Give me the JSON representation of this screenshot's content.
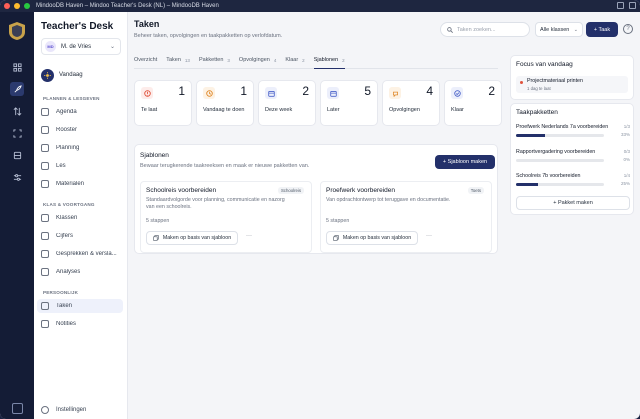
{
  "window": {
    "title": "MindooDB Haven – Mindoo Teacher's Desk (NL) – MindooDB Haven"
  },
  "app": {
    "brand": "Teacher's Desk"
  },
  "user": {
    "initials": "MD",
    "name": "M. de Vries"
  },
  "sidebar": {
    "today": "Vandaag",
    "section1": "PLANNEN & LESGEVEN",
    "items1": [
      "Agenda",
      "Rooster",
      "Planning",
      "Les",
      "Materialen"
    ],
    "section2": "KLAS & VOORTGANG",
    "items2": [
      "Klassen",
      "Cijfers",
      "Gesprekken & versla...",
      "Analyses"
    ],
    "section3": "PERSOONLIJK",
    "items3": [
      "Taken",
      "Notities"
    ],
    "settings": "Instellingen"
  },
  "header": {
    "title": "Taken",
    "subtitle": "Beheer taken, opvolgingen en taakpakketten op verlofdatum.",
    "search_placeholder": "Taken zoeken...",
    "filter": "Alle klassen",
    "add_task": "+ Taak",
    "help": "?"
  },
  "tabs": [
    {
      "label": "Overzicht",
      "count": ""
    },
    {
      "label": "Taken",
      "count": "13"
    },
    {
      "label": "Pakketten",
      "count": "3"
    },
    {
      "label": "Opvolgingen",
      "count": "4"
    },
    {
      "label": "Klaar",
      "count": "2"
    },
    {
      "label": "Sjablonen",
      "count": "2"
    }
  ],
  "active_tab": "Sjablonen",
  "stats": [
    {
      "label": "Te laat",
      "value": "1",
      "icon": "alert-icon",
      "color": "#e0533d",
      "bg": "#fdecea"
    },
    {
      "label": "Vandaag te doen",
      "value": "1",
      "icon": "clock-icon",
      "color": "#e08a2c",
      "bg": "#fdf2e4"
    },
    {
      "label": "Deze week",
      "value": "2",
      "icon": "calendar-icon",
      "color": "#4b63c9",
      "bg": "#eceffb"
    },
    {
      "label": "Later",
      "value": "5",
      "icon": "calendar-icon",
      "color": "#4b63c9",
      "bg": "#eceffb"
    },
    {
      "label": "Opvolgingen",
      "value": "4",
      "icon": "followup-icon",
      "color": "#e08a2c",
      "bg": "#fdf2e4"
    },
    {
      "label": "Klaar",
      "value": "2",
      "icon": "check-icon",
      "color": "#4b63c9",
      "bg": "#eceffb"
    }
  ],
  "templates": {
    "title": "Sjablonen",
    "subtitle": "Bewaar terugkerende taakreeksen en maak er nieuwe pakketten van.",
    "new_button": "+ Sjabloon maken",
    "cards": [
      {
        "title": "Schoolreis voorbereiden",
        "badge": "Schoolreis",
        "description": "Standaardvolgorde voor planning, communicatie en nazorg van een schoolreis.",
        "steps": "5 stappen",
        "action": "Maken op basis van sjabloon",
        "more": "···"
      },
      {
        "title": "Proefwerk voorbereiden",
        "badge": "Toets",
        "description": "Van opdrachtontwerp tot teruggave en documentatie.",
        "steps": "5 stappen",
        "action": "Maken op basis van sjabloon",
        "more": "···"
      }
    ]
  },
  "focus": {
    "title": "Focus van vandaag",
    "item_title": "Projectmateriaal printen",
    "item_sub": "1 dag te laat"
  },
  "packages": {
    "title": "Taakpakketten",
    "items": [
      {
        "name": "Proefwerk Nederlands 7a voorbereiden",
        "count": "1/3",
        "percent": "33%",
        "fraction": 0.33
      },
      {
        "name": "Rapportvergadering voorbereiden",
        "count": "0/3",
        "percent": "0%",
        "fraction": 0
      },
      {
        "name": "Schoolreis 7b voorbereiden",
        "count": "1/4",
        "percent": "25%",
        "fraction": 0.25
      }
    ],
    "button": "+ Pakket maken"
  },
  "colors": {
    "accent": "#23306a",
    "rail": "#141c36",
    "danger": "#e0533d"
  }
}
